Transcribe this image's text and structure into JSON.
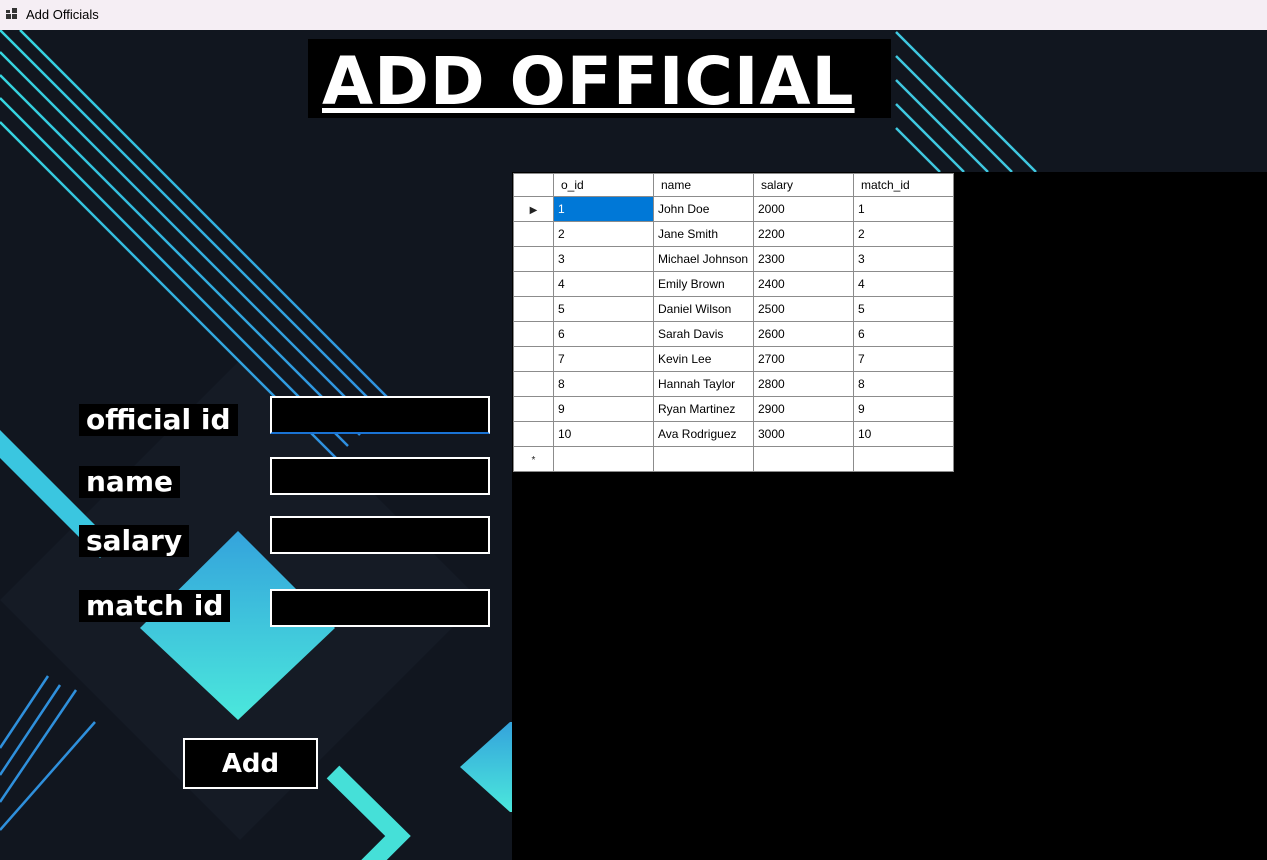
{
  "window": {
    "title": "Add Officials",
    "icon": "app-window-icon"
  },
  "heading": "ADD OFFICIAL",
  "form": {
    "fields": [
      {
        "label": "official id",
        "value": ""
      },
      {
        "label": "name",
        "value": ""
      },
      {
        "label": "salary",
        "value": ""
      },
      {
        "label": "match id",
        "value": ""
      }
    ],
    "add_label": "Add"
  },
  "grid": {
    "columns": [
      "o_id",
      "name",
      "salary",
      "match_id"
    ],
    "rows": [
      [
        "1",
        "John Doe",
        "2000",
        "1"
      ],
      [
        "2",
        "Jane Smith",
        "2200",
        "2"
      ],
      [
        "3",
        "Michael Johnson",
        "2300",
        "3"
      ],
      [
        "4",
        "Emily Brown",
        "2400",
        "4"
      ],
      [
        "5",
        "Daniel Wilson",
        "2500",
        "5"
      ],
      [
        "6",
        "Sarah Davis",
        "2600",
        "6"
      ],
      [
        "7",
        "Kevin Lee",
        "2700",
        "7"
      ],
      [
        "8",
        "Hannah Taylor",
        "2800",
        "8"
      ],
      [
        "9",
        "Ryan Martinez",
        "2900",
        "9"
      ],
      [
        "10",
        "Ava Rodriguez",
        "3000",
        "10"
      ]
    ],
    "current_row_marker": "▶",
    "new_row_marker": "*",
    "selected_cell": {
      "row": 0,
      "column": "o_id"
    }
  },
  "colors": {
    "background": "#11161f",
    "line_accent": "#3ab0e0",
    "diamond_top": "#34a3dc",
    "diamond_bottom": "#4be8dc",
    "selection": "#0078d7"
  }
}
